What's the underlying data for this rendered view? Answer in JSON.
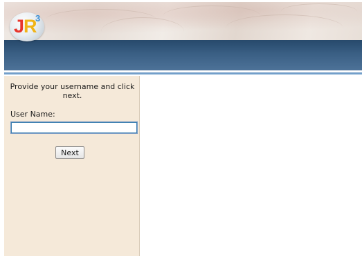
{
  "header": {
    "logo": {
      "letters": [
        "J",
        "R",
        "3"
      ],
      "colors": {
        "j": "#e8352b",
        "r": "#f0b418",
        "three": "#3a8fd6"
      }
    },
    "band_color": "#3a5f84"
  },
  "login": {
    "instructions": "Provide your username and click next.",
    "username_label": "User Name:",
    "username_value": "",
    "next_label": "Next"
  },
  "colors": {
    "sidebar_background": "#f5e9d9",
    "input_border": "#3c7fb1"
  }
}
